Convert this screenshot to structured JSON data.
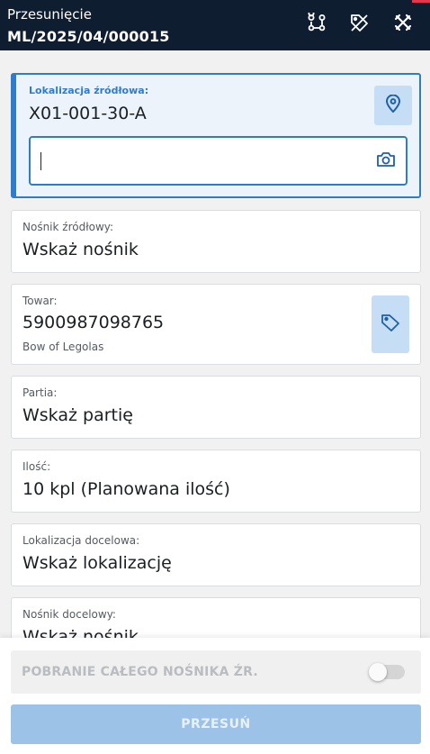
{
  "header": {
    "title": "Przesunięcie",
    "document_number": "ML/2025/04/000015",
    "icons": [
      "route-icon",
      "tag-off-icon",
      "cancel-tools-icon"
    ]
  },
  "fields": {
    "source_location": {
      "label": "Lokalizacja źródłowa:",
      "value": "X01-001-30-A",
      "input_value": "",
      "icon": "map-pin-icon",
      "input_icon": "camera-icon"
    },
    "source_carrier": {
      "label": "Nośnik źródłowy:",
      "value": "Wskaż nośnik"
    },
    "item": {
      "label": "Towar:",
      "value": "5900987098765",
      "description": "Bow of Legolas",
      "icon": "tag-icon"
    },
    "batch": {
      "label": "Partia:",
      "value": "Wskaż partię"
    },
    "quantity": {
      "label": "Ilość:",
      "value": "10 kpl (Planowana ilość)"
    },
    "target_location": {
      "label": "Lokalizacja docelowa:",
      "value": "Wskaż lokalizację"
    },
    "target_carrier": {
      "label": "Nośnik docelowy:",
      "value": "Wskaż nośnik"
    }
  },
  "footer": {
    "toggle_label": "POBRANIE CAŁEGO NOŚNIKA ŹR.",
    "toggle_on": false,
    "submit_label": "PRZESUŃ"
  },
  "colors": {
    "header_bg": "#0f1d30",
    "accent_blue": "#2f7cc9",
    "icon_button_bg": "#c6def5",
    "submit_disabled": "#9cc2e8",
    "header_accent": "#e3374d"
  }
}
